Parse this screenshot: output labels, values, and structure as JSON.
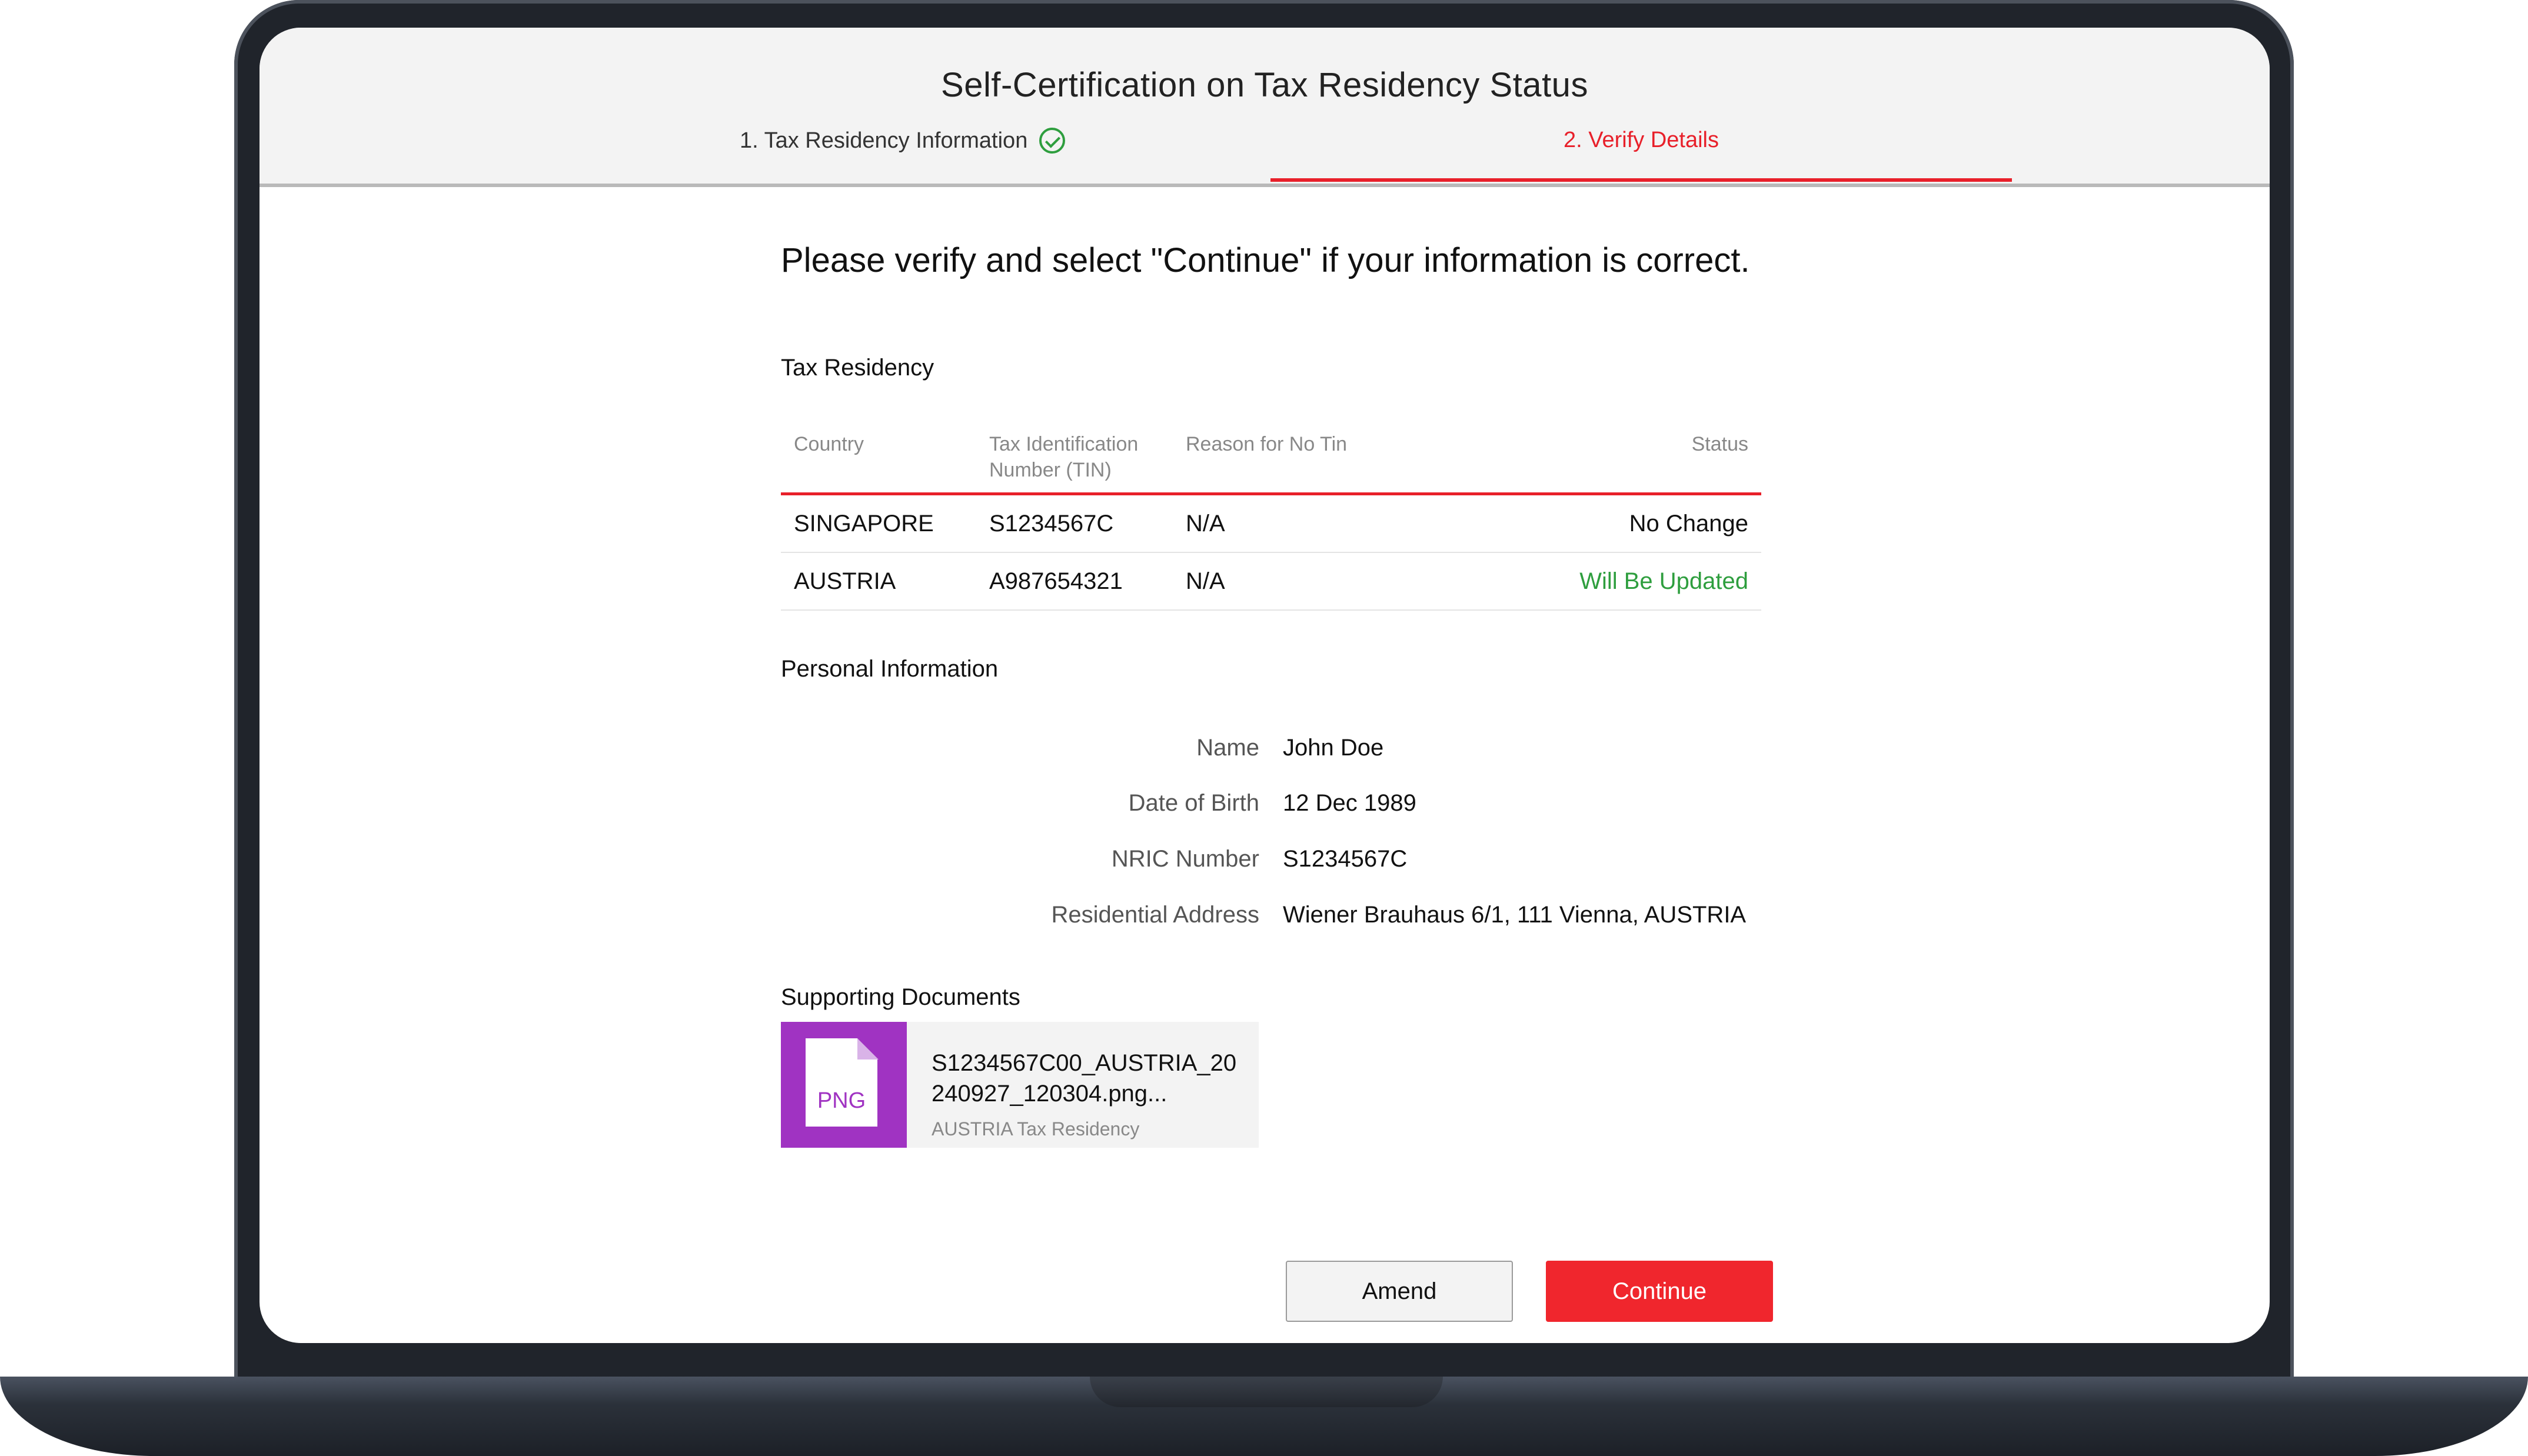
{
  "header": {
    "title": "Self-Certification on Tax Residency Status",
    "steps": [
      {
        "label": "1.  Tax Residency Information",
        "state": "complete",
        "icon": "check-circle-icon"
      },
      {
        "label": "2.  Verify Details",
        "state": "active"
      }
    ]
  },
  "prompt": "Please verify and select \"Continue\" if your information is correct.",
  "tax_residency": {
    "title": "Tax Residency",
    "columns": {
      "country": "Country",
      "tin_line1": "Tax Identification",
      "tin_line2": "Number (TIN)",
      "reason": "Reason for No Tin",
      "status": "Status"
    },
    "rows": [
      {
        "country": "SINGAPORE",
        "tin": "S1234567C",
        "reason": "N/A",
        "status": "No Change"
      },
      {
        "country": "AUSTRIA",
        "tin": "A987654321",
        "reason": "N/A",
        "status": "Will Be Updated"
      }
    ]
  },
  "personal_information": {
    "title": "Personal Information",
    "fields": [
      {
        "label": "Name",
        "value": "John Doe"
      },
      {
        "label": "Date of Birth",
        "value": "12 Dec 1989"
      },
      {
        "label": "NRIC Number",
        "value": "S1234567C"
      },
      {
        "label": "Residential Address",
        "value": "Wiener Brauhaus 6/1, 111 Vienna, AUSTRIA"
      }
    ]
  },
  "supporting_documents": {
    "title": "Supporting Documents",
    "file": {
      "type": "PNG",
      "name": "S1234567C00_AUSTRIA_20240927_120304.png...",
      "subtitle": "AUSTRIA Tax Residency"
    }
  },
  "actions": {
    "amend": "Amend",
    "continue": "Continue"
  },
  "colors": {
    "accent": "#e8202a",
    "success": "#2e9e3e",
    "file_thumb": "#a033c2"
  }
}
